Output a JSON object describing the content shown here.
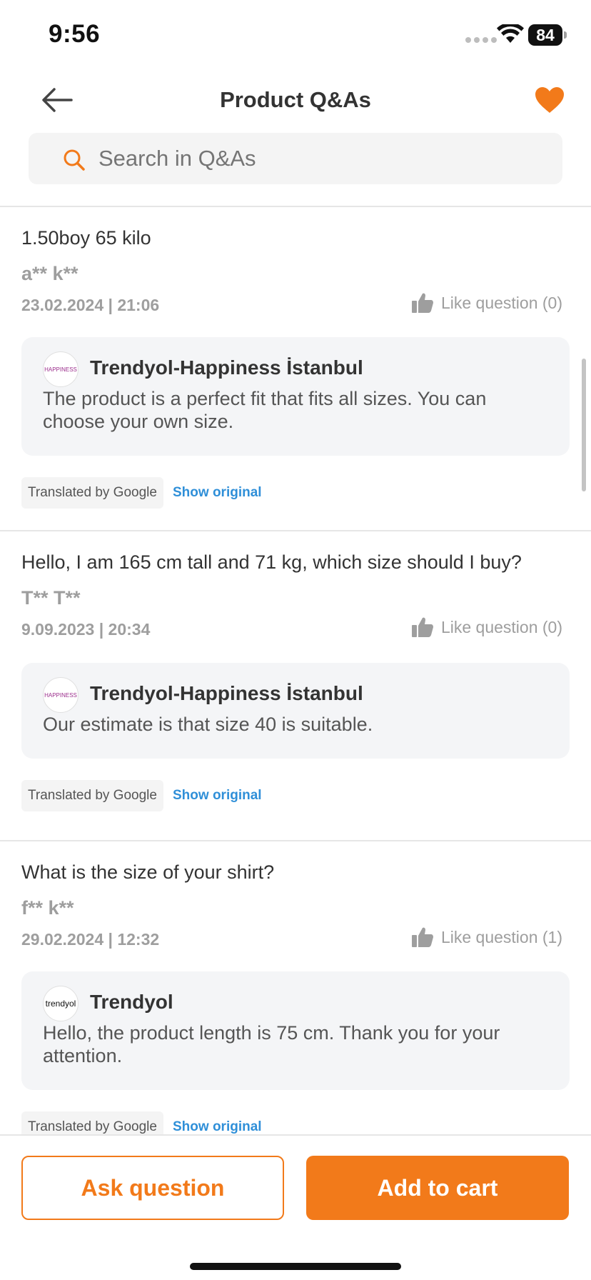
{
  "status_bar": {
    "time": "9:56",
    "battery": "84"
  },
  "header": {
    "title": "Product Q&As",
    "icons": [
      "back-arrow-icon",
      "heart-icon"
    ]
  },
  "search": {
    "placeholder": "Search in Q&As"
  },
  "qa_items": [
    {
      "question": "1.50boy 65 kilo",
      "asker": "a** k**",
      "date": "23.02.2024 | 21:06",
      "like_label": "Like question (0)",
      "seller": "Trendyol-Happiness İstanbul",
      "seller_logo_text": "HAPPINESS",
      "answer": "The product is a perfect fit that fits all sizes. You can choose your own size.",
      "translated_label": "Translated by Google",
      "show_original_label": "Show original"
    },
    {
      "question": "Hello, I am 165 cm tall and 71 kg, which size should I buy?",
      "asker": "T** T**",
      "date": "9.09.2023 | 20:34",
      "like_label": "Like question (0)",
      "seller": "Trendyol-Happiness İstanbul",
      "seller_logo_text": "HAPPINESS",
      "answer": "Our estimate is that size 40 is suitable.",
      "translated_label": "Translated by Google",
      "show_original_label": "Show original"
    },
    {
      "question": "What is the size of your shirt?",
      "asker": "f** k**",
      "date": "29.02.2024 | 12:32",
      "like_label": "Like question (1)",
      "seller": "Trendyol",
      "seller_logo_text": "trendyol",
      "answer": "Hello, the product length is 75 cm. Thank you for your attention.",
      "translated_label": "Translated by Google",
      "show_original_label": "Show original"
    }
  ],
  "bottom_bar": {
    "ask_label": "Ask question",
    "cart_label": "Add to cart"
  },
  "colors": {
    "accent": "#f27a1a",
    "link": "#2f8fd8",
    "muted": "#9e9e9e",
    "answer_bg": "#f4f5f7"
  }
}
